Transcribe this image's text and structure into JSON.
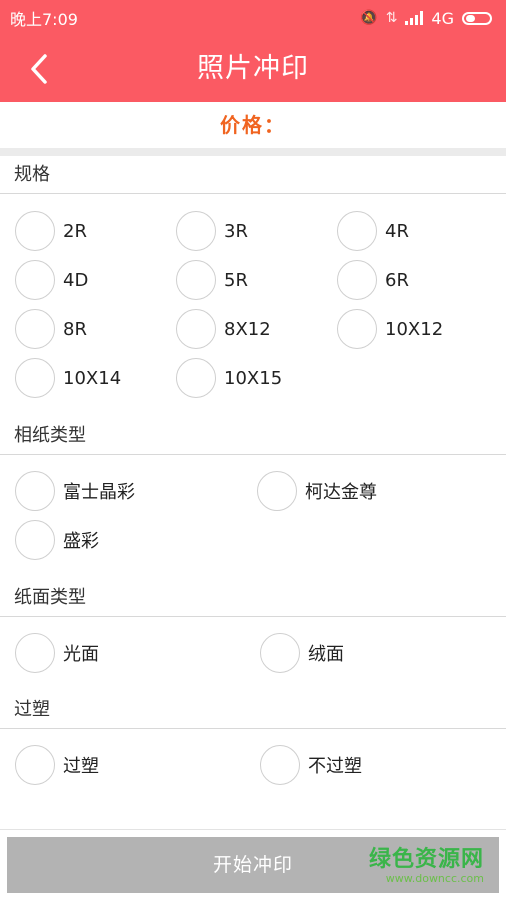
{
  "status_bar": {
    "time": "晚上7:09",
    "network": "4G"
  },
  "header": {
    "title": "照片冲印"
  },
  "price": {
    "label": "价格："
  },
  "sections": {
    "size": {
      "title": "规格",
      "options": [
        "2R",
        "3R",
        "4R",
        "4D",
        "5R",
        "6R",
        "8R",
        "8X12",
        "10X12",
        "10X14",
        "10X15"
      ]
    },
    "paper": {
      "title": "相纸类型",
      "options": [
        "富士晶彩",
        "柯达金尊",
        "盛彩"
      ]
    },
    "surface": {
      "title": "纸面类型",
      "options": [
        "光面",
        "绒面"
      ]
    },
    "laminate": {
      "title": "过塑",
      "options": [
        "过塑",
        "不过塑"
      ]
    }
  },
  "bottom": {
    "start_label": "开始冲印"
  },
  "watermark": {
    "main": "绿色资源网",
    "sub": "www.downcc.com"
  },
  "colors": {
    "brand": "#fb5a63",
    "price": "#f06420",
    "button_disabled": "#b3b3b3"
  }
}
